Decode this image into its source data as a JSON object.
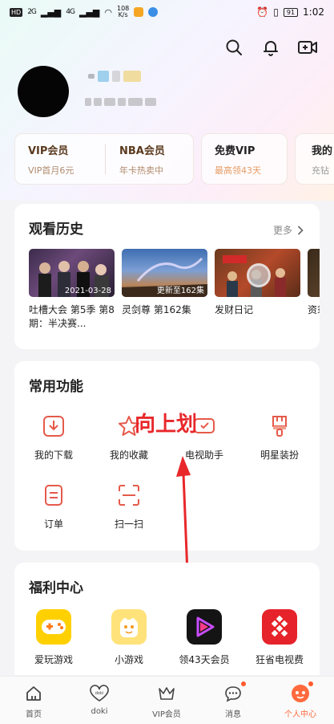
{
  "status_bar": {
    "hd": "HD",
    "signal1": "2G",
    "signal2": "4G",
    "speed_value": "108",
    "speed_unit": "K/s",
    "battery": "91",
    "time": "1:02"
  },
  "header": {
    "icons": [
      "search-icon",
      "bell-icon",
      "video-add-icon"
    ]
  },
  "vip_cards": [
    {
      "title": "VIP会员",
      "subtitle": "VIP首月6元"
    },
    {
      "title": "NBA会员",
      "subtitle": "年卡热卖中"
    },
    {
      "title": "免费VIP",
      "subtitle": "最高领43天"
    },
    {
      "title": "我的",
      "subtitle": "充钻"
    }
  ],
  "history": {
    "title": "观看历史",
    "more": "更多",
    "items": [
      {
        "caption": "2021-03-28",
        "title": "吐槽大会 第5季 第8期：半决赛..."
      },
      {
        "caption": "更新至162集",
        "title": "灵剑尊 第162集"
      },
      {
        "caption": "",
        "title": "发财日记"
      },
      {
        "caption": "",
        "title": "资翁"
      }
    ]
  },
  "functions": {
    "title": "常用功能",
    "items": [
      {
        "label": "我的下载",
        "icon": "download-icon"
      },
      {
        "label": "我的收藏",
        "icon": "star-icon"
      },
      {
        "label": "电视助手",
        "icon": "tv-icon"
      },
      {
        "label": "明星装扮",
        "icon": "brush-icon"
      },
      {
        "label": "订单",
        "icon": "order-icon"
      },
      {
        "label": "扫一扫",
        "icon": "scan-icon"
      }
    ]
  },
  "overlay": {
    "text": "向上划"
  },
  "welfare": {
    "title": "福利中心",
    "items": [
      {
        "label": "爱玩游戏",
        "icon": "gamepad-icon"
      },
      {
        "label": "小游戏",
        "icon": "mini-game-icon"
      },
      {
        "label": "领43天会员",
        "icon": "video-member-icon"
      },
      {
        "label": "狂省电视费",
        "icon": "tv-savings-icon"
      }
    ]
  },
  "bottom_nav": [
    {
      "label": "首页",
      "icon": "home-icon"
    },
    {
      "label": "doki",
      "icon": "doki-icon"
    },
    {
      "label": "VIP会员",
      "icon": "crown-icon"
    },
    {
      "label": "消息",
      "icon": "message-icon"
    },
    {
      "label": "个人中心",
      "icon": "profile-icon"
    }
  ],
  "colors": {
    "accent": "#ff6a3d",
    "overlay_red": "#e8272a",
    "vip_gold": "#b08a6c"
  }
}
